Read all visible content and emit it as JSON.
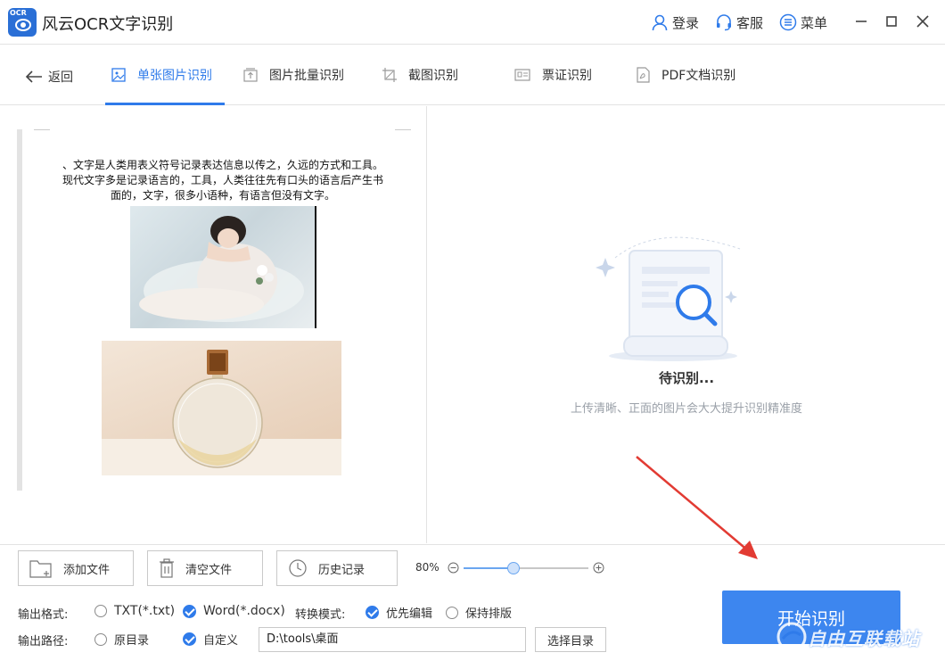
{
  "app": {
    "title": "风云OCR文字识别",
    "logo_text": "OCR"
  },
  "header": {
    "login": "登录",
    "service": "客服",
    "menu": "菜单"
  },
  "colors": {
    "accent": "#2f7bea",
    "start_button": "#3d86ef",
    "arrow": "#e23b33"
  },
  "nav": {
    "back": "返回",
    "tabs": [
      {
        "label": "单张图片识别",
        "active": true
      },
      {
        "label": "图片批量识别",
        "active": false
      },
      {
        "label": "截图识别",
        "active": false
      },
      {
        "label": "票证识别",
        "active": false
      },
      {
        "label": "PDF文档识别",
        "active": false
      }
    ]
  },
  "preview": {
    "lines": [
      "、文字是人类用表义符号记录表达信息以传之，久远的方式和工具。",
      "现代文字多是记录语言的，工具，人类往往先有口头的语言后产生书",
      "面的，文字，很多小语种，有语言但没有文字。"
    ],
    "images": [
      "girl-photo",
      "perfume-photo"
    ]
  },
  "result": {
    "status": "待识别...",
    "tip": "上传清晰、正面的图片会大大提升识别精准度"
  },
  "toolbar": {
    "add_file": "添加文件",
    "clear_files": "清空文件",
    "history": "历史记录",
    "zoom_label": "80%",
    "zoom_value": 0.4
  },
  "options": {
    "format_label": "输出格式:",
    "format_txt": "TXT(*.txt)",
    "format_word": "Word(*.docx)",
    "mode_label": "转换模式:",
    "mode_edit": "优先编辑",
    "mode_layout": "保持排版",
    "path_label": "输出路径:",
    "path_original": "原目录",
    "path_custom": "自定义",
    "path_value": "D:\\tools\\桌面",
    "choose_dir": "选择目录",
    "start": "开始识别"
  },
  "watermark": {
    "text": "自由互联载站"
  }
}
